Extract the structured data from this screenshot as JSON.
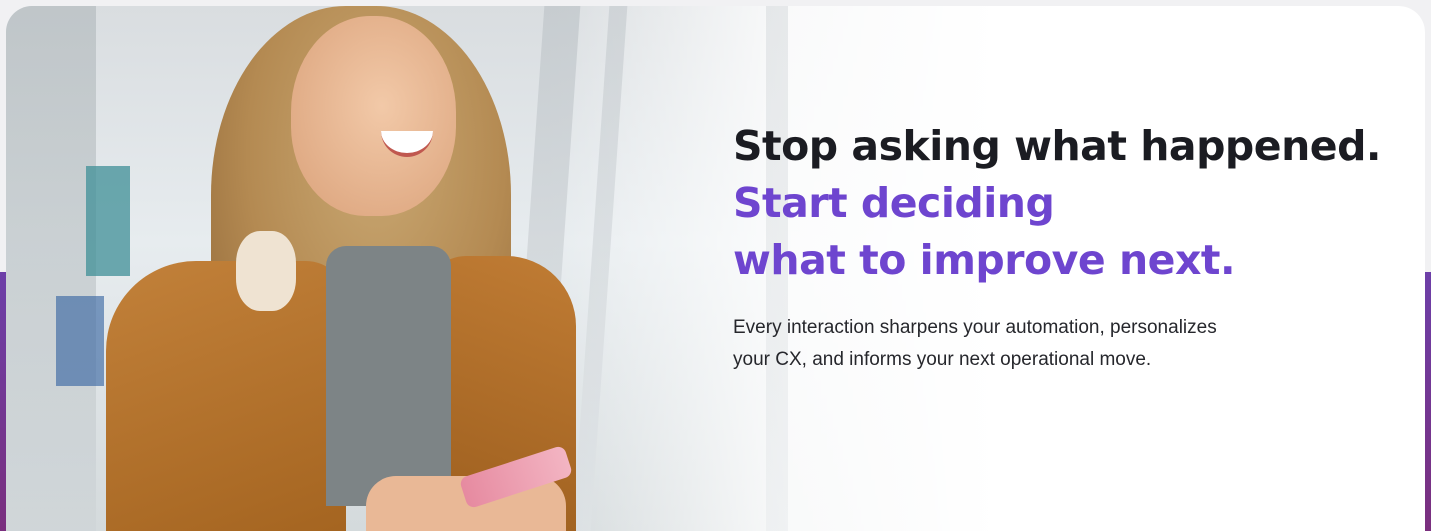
{
  "hero": {
    "headline_line1": "Stop asking what happened.",
    "headline_line2": "Start deciding",
    "headline_line3": "what to improve next.",
    "body": "Every interaction sharpens your automation, personalizes your CX, and informs your next operational move."
  },
  "colors": {
    "accent": "#6e45cf",
    "headline_dark": "#1b1c22",
    "band_purple": "#6d3fa8",
    "card_background": "#ffffff"
  }
}
